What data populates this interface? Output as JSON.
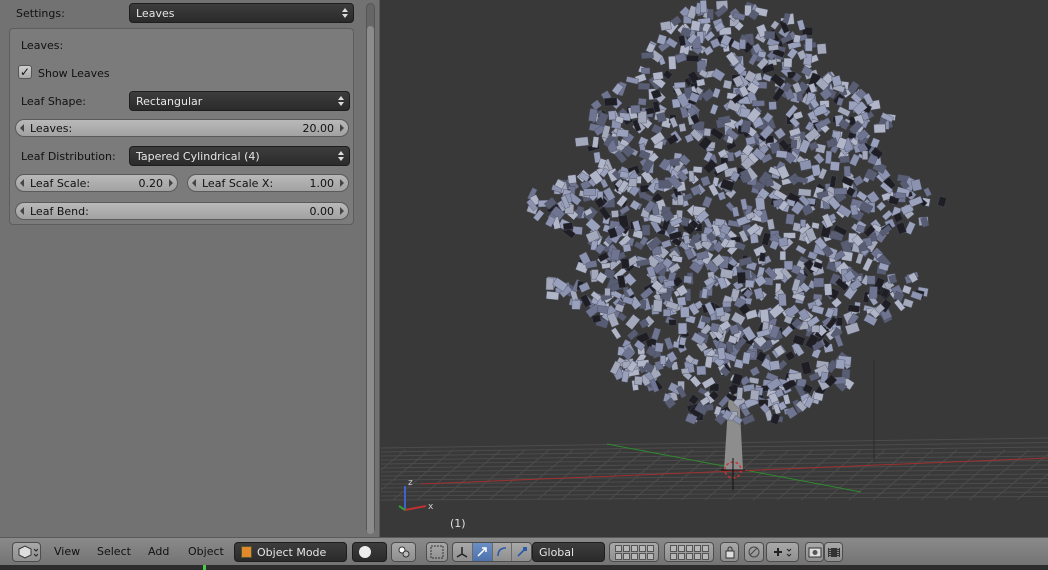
{
  "panel": {
    "settings_label": "Settings:",
    "settings_value": "Leaves",
    "section_title": "Leaves:",
    "show_leaves": {
      "label": "Show Leaves",
      "checked": true
    },
    "leaf_shape": {
      "label": "Leaf Shape:",
      "value": "Rectangular"
    },
    "leaves": {
      "label": "Leaves:",
      "value": "20.00"
    },
    "leaf_distribution": {
      "label": "Leaf Distribution:",
      "value": "Tapered Cylindrical (4)"
    },
    "leaf_scale": {
      "label": "Leaf Scale:",
      "value": "0.20"
    },
    "leaf_scale_x": {
      "label": "Leaf Scale X:",
      "value": "1.00"
    },
    "leaf_bend": {
      "label": "Leaf Bend:",
      "value": "0.00"
    }
  },
  "viewport": {
    "frame_label": "(1)",
    "axis_labels": {
      "x": "x",
      "z": "z"
    },
    "colors": {
      "background": "#393939",
      "leaves": "#8b93b0",
      "x_axis": "#a03030",
      "y_axis": "#2e8a2e"
    }
  },
  "header": {
    "menu": [
      "View",
      "Select",
      "Add",
      "Object"
    ],
    "mode": "Object Mode",
    "orientation": "Global"
  },
  "icons": [
    "view3d-editor-icon",
    "shading-solid-icon",
    "pivot-point-icon",
    "manipulator-icon",
    "translate-icon",
    "rotate-icon",
    "scale-icon",
    "layers-icon",
    "lock-camera-icon",
    "snap-icon",
    "render-icon",
    "animation-render-icon"
  ]
}
